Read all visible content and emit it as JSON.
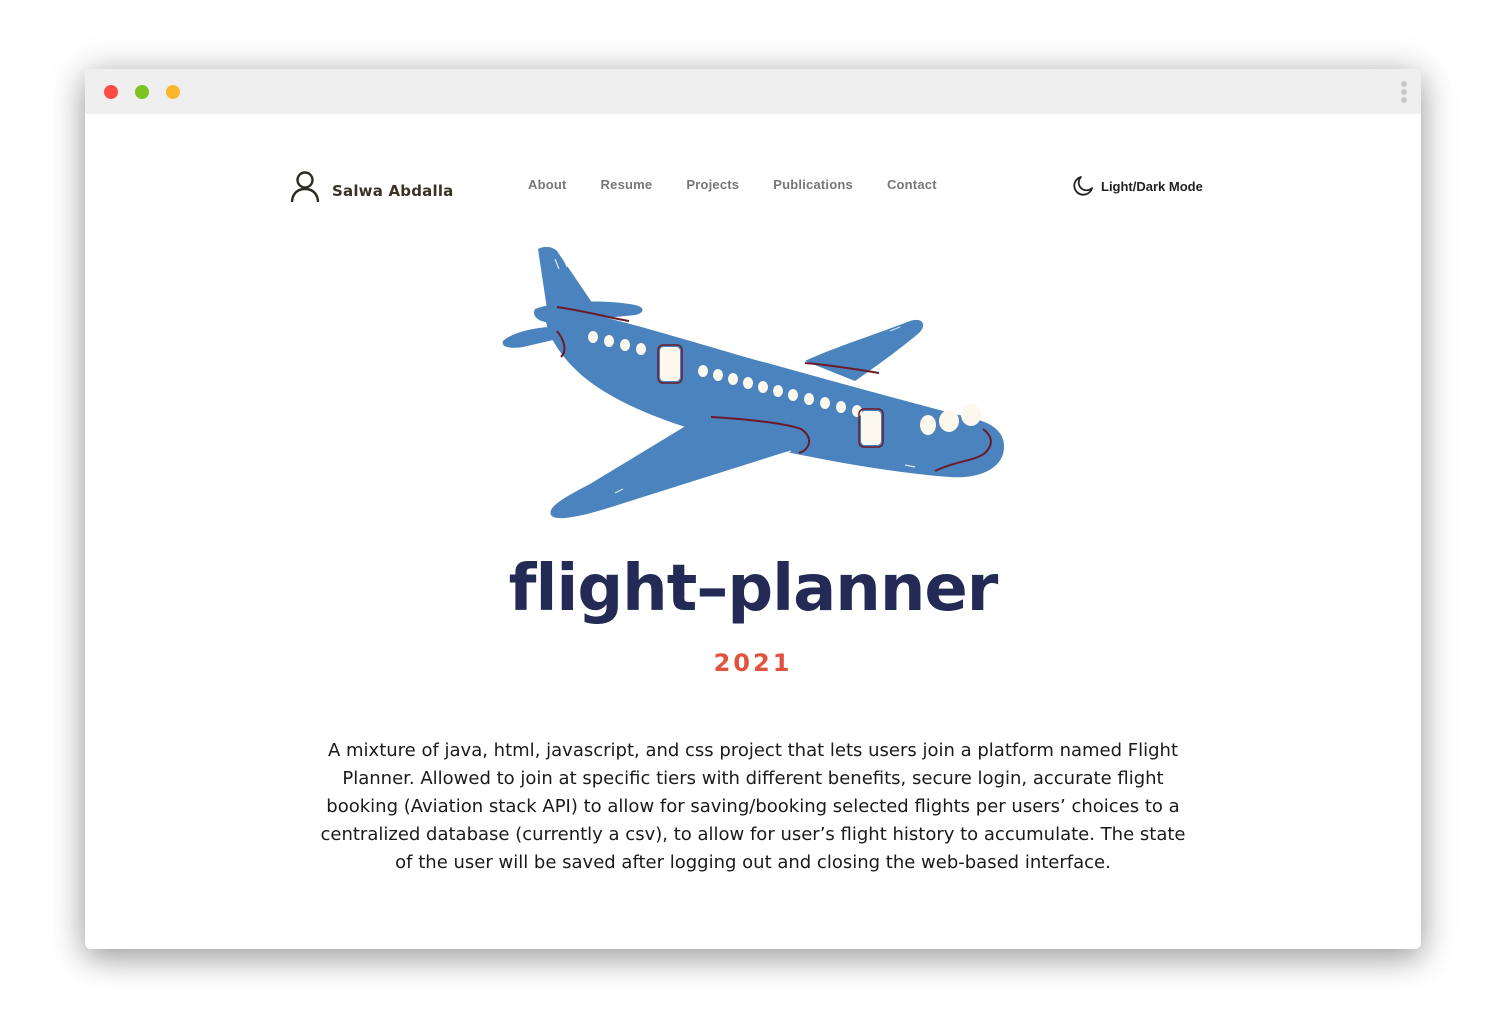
{
  "browser": {
    "window_controls": [
      "close",
      "minimize",
      "maximize"
    ],
    "menu_icon": "kebab-menu-icon"
  },
  "header": {
    "brand_icon": "user-icon",
    "brand_name": "Salwa Abdalla",
    "nav_items": [
      "About",
      "Resume",
      "Projects",
      "Publications",
      "Contact"
    ],
    "theme_toggle_icon": "moon-icon",
    "theme_toggle_label": "Light/Dark Mode"
  },
  "project": {
    "image_icon": "airplane-illustration",
    "title": "flight–planner",
    "year": "2021",
    "description": "A mixture of java, html, javascript, and css project that lets users join a platform named Flight Planner. Allowed to join at specific tiers with different benefits, secure login, accurate flight booking (Aviation stack API) to allow for saving/booking selected flights per users’ choices to a centralized database (currently a csv), to allow for user’s flight history to accumulate. The state of the user will be saved after logging out and closing the web-based interface."
  },
  "colors": {
    "title": "#222a55",
    "year": "#e2523d",
    "plane_body": "#4a83bd",
    "plane_trim": "#6a1b2a",
    "window_white": "#fdf8ee"
  }
}
